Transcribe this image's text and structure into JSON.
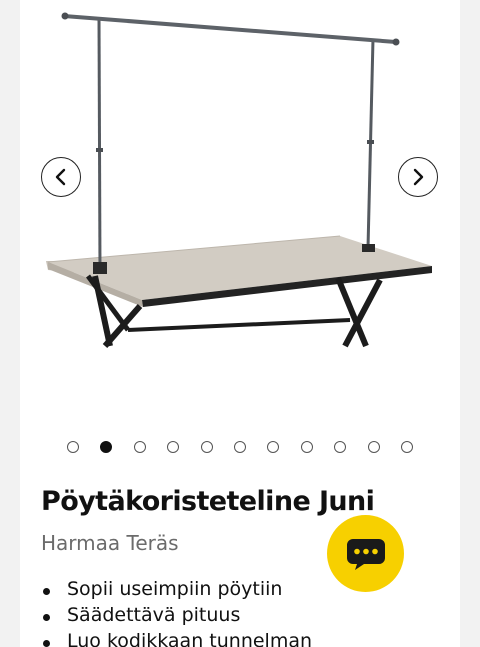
{
  "product": {
    "title": "Pöytäkoristeteline Juni",
    "variant": "Harmaa Teräs",
    "features": [
      "Sopii useimpiin pöytiin",
      "Säädettävä pituus",
      "Luo kodikkaan tunnelman"
    ]
  },
  "gallery": {
    "image_count": 11,
    "active_index": 1,
    "prev_icon": "chevron-left-icon",
    "next_icon": "chevron-right-icon"
  },
  "chat": {
    "icon": "chat-bubble-icon",
    "color": "#f7d000"
  },
  "colors": {
    "background": "#f2f2f2",
    "card": "#ffffff",
    "title": "#111111",
    "subtitle": "#6b6b6b",
    "accent": "#f7d000"
  }
}
